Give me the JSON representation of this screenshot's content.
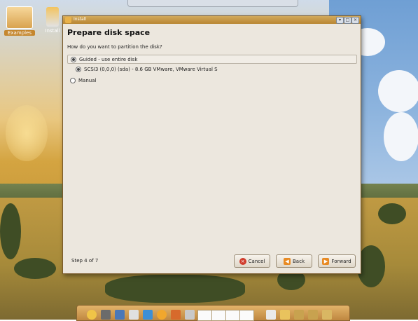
{
  "desktop": {
    "icons": [
      {
        "label": "Examples"
      },
      {
        "label": "Install"
      }
    ]
  },
  "window": {
    "title": "Install",
    "heading": "Prepare disk space",
    "question": "How do you want to partition the disk?",
    "options": [
      {
        "label": "Guided - use entire disk",
        "selected": true
      },
      {
        "label": "SCSI3 (0,0,0) (sda) - 8.6 GB VMware, VMware Virtual S",
        "selected": true
      },
      {
        "label": "Manual",
        "selected": false
      }
    ],
    "step": "Step 4 of 7",
    "buttons": {
      "cancel": "Cancel",
      "back": "Back",
      "forward": "Forward"
    }
  },
  "colors": {
    "titlebar": "#b98632",
    "window_bg": "#ece7de",
    "cancel_icon": "#d03a2a",
    "arrow_icon": "#e88a23"
  }
}
